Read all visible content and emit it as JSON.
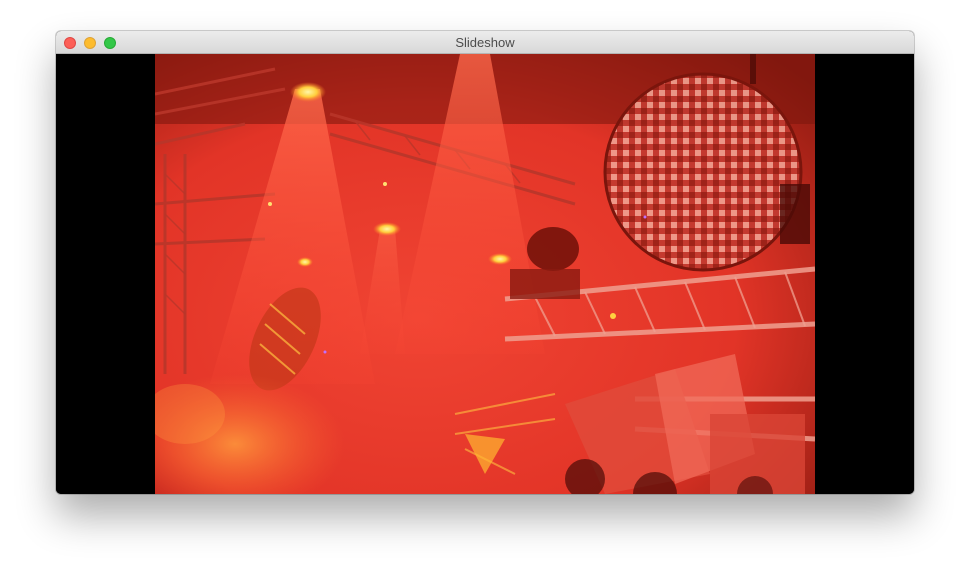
{
  "window": {
    "title": "Slideshow",
    "controls": {
      "close": "close",
      "minimize": "minimize",
      "zoom": "zoom"
    }
  },
  "slide": {
    "image_icon": "photo-stage-lights-icon",
    "colors": {
      "base": "#e8372c",
      "dark": "#6e1008",
      "highlight": "#ffd84a"
    }
  }
}
